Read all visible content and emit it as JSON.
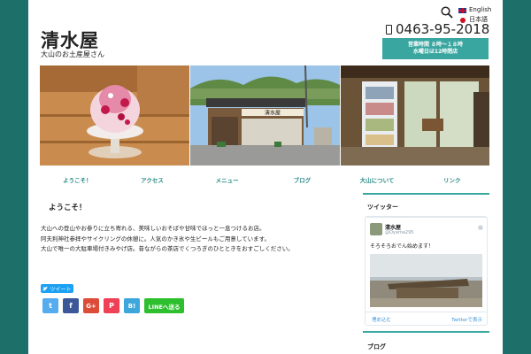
{
  "site": {
    "title": "清水屋",
    "subtitle": "大山のお土産屋さん"
  },
  "lang": {
    "english": "English",
    "japanese": "日本語"
  },
  "contact": {
    "phone": "0463-95-2018",
    "hours_line1": "営業時間 ８時〜１８時",
    "hours_line2": "水曜日は12時閉店"
  },
  "hero": {
    "sign": "清水屋"
  },
  "nav": [
    "ようこそ！",
    "アクセス",
    "メニュー",
    "ブログ",
    "大山について",
    "リンク"
  ],
  "main": {
    "heading": "ようこそ！",
    "lines": [
      "大山への登山やお参りに立ち寄れる、美味しいおそばや甘味でほっと一息つけるお店。",
      "阿夫利神社参拝やサイクリングの休憩に。人気のかき氷や生ビールもご用意しています。",
      "大山で唯一の大駐車場付きみやげ店。昔ながらの茶店でくつろぎのひとときをおすごしください。"
    ]
  },
  "share": {
    "tweet_label": "ツイート",
    "twitter": "t",
    "facebook": "f",
    "google": "G+",
    "pocket": "P",
    "hatena": "B!",
    "line": "LINEへ送る"
  },
  "sidebar": {
    "twitter_heading": "ツイッター",
    "tweet_name": "清水屋",
    "tweet_handle": "@Oyama295",
    "tweet_text": "そろそろおでん始めます！",
    "embed_label": "埋め込む",
    "view_on_twitter": "Twitterで表示",
    "blog_heading": "ブログ"
  },
  "colors": {
    "accent": "#3aa6a0",
    "background": "#1d6f6a",
    "twitter": "#1da1f2"
  }
}
